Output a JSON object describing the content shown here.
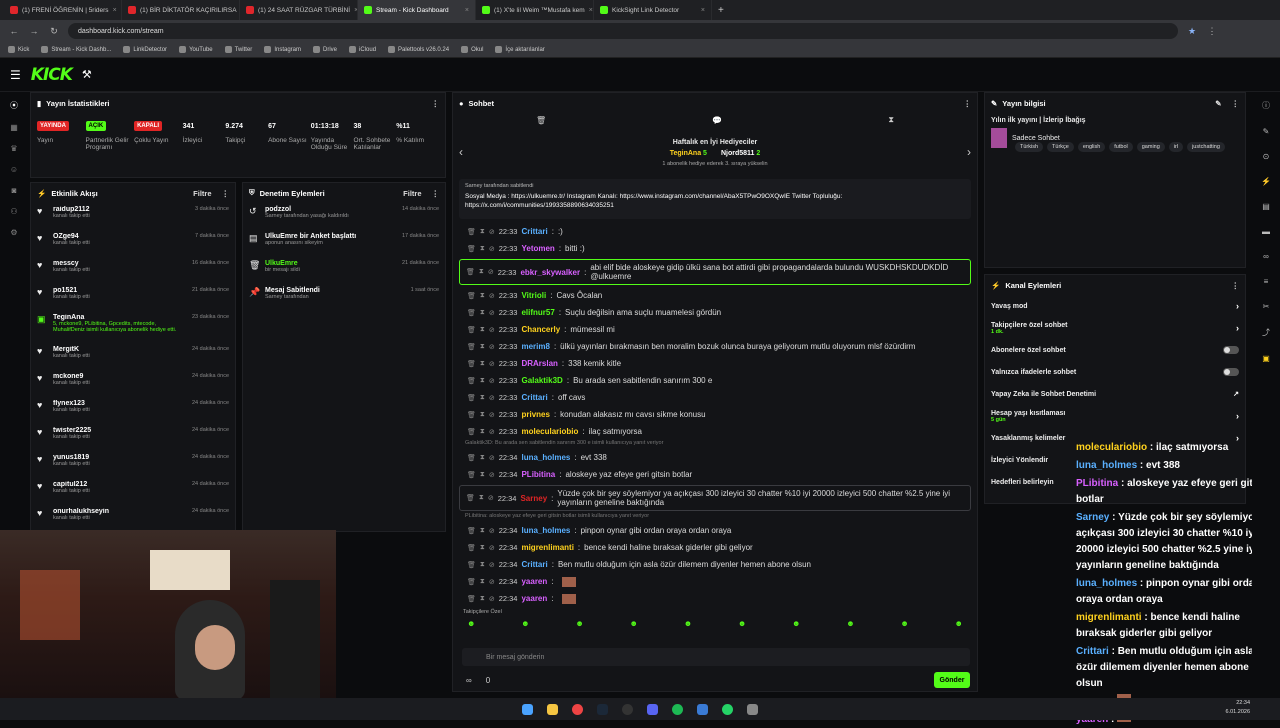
{
  "browser": {
    "tabs": [
      "(1) FRENİ ÖĞRENİN | 5riders",
      "(1) BİR DİKTATÖR KAÇIRILIRSA",
      "(1) 24 SAAT RÜZGAR TÜRBİNİ",
      "Stream - Kick Dashboard",
      "(1) X'te lil Weim ™Mustafa kem",
      "KickSight Link Detector"
    ],
    "url": "dashboard.kick.com/stream",
    "bookmarks": [
      "Kick",
      "Stream - Kick Dashb...",
      "LinkDetector",
      "YouTube",
      "Twitter",
      "Instagram",
      "Drive",
      "iCloud",
      "Palettools v26.0.24",
      "Okul",
      "İçe aktarılanlar"
    ]
  },
  "stats": {
    "title": "Yayın İstatistikleri",
    "items": [
      {
        "value": "YAYINDA",
        "label": "Yayın",
        "kind": "red"
      },
      {
        "value": "AÇIK",
        "label": "Partnerlik Gelir Programı",
        "kind": "grn"
      },
      {
        "value": "KAPALI",
        "label": "Çoklu Yayın",
        "kind": "red"
      },
      {
        "value": "341",
        "label": "İzleyici"
      },
      {
        "value": "9.274",
        "label": "Takipçi"
      },
      {
        "value": "67",
        "label": "Abone Sayısı"
      },
      {
        "value": "01:13:18",
        "label": "Yayında Olduğu Süre"
      },
      {
        "value": "38",
        "label": "Ort. Sohbete Katılanlar"
      },
      {
        "value": "%11",
        "label": "% Katılım"
      }
    ]
  },
  "activity": {
    "title": "Etkinlik Akışı",
    "filter": "Filtre",
    "items": [
      {
        "name": "raidup2112",
        "sub": "kanalı takip etti",
        "time": "3 dakika önce"
      },
      {
        "name": "OZge94",
        "sub": "kanalı takip etti",
        "time": "7 dakika önce"
      },
      {
        "name": "messcy",
        "sub": "kanalı takip etti",
        "time": "16 dakika önce"
      },
      {
        "name": "po1521",
        "sub": "kanalı takip etti",
        "time": "21 dakika önce"
      },
      {
        "name": "TeginAna",
        "sub": "5, mckone9, PLibitina, Gpcedits, mtecode, MuhalifDeniz isimli kullanıcıya abonelik hediye etti.",
        "time": "23 dakika önce"
      },
      {
        "name": "MergitK",
        "sub": "kanalı takip etti",
        "time": "24 dakika önce"
      },
      {
        "name": "mckone9",
        "sub": "kanalı takip etti",
        "time": "24 dakika önce"
      },
      {
        "name": "flynex123",
        "sub": "kanalı takip etti",
        "time": "24 dakika önce"
      },
      {
        "name": "twister2225",
        "sub": "kanalı takip etti",
        "time": "24 dakika önce"
      },
      {
        "name": "yunus1819",
        "sub": "kanalı takip etti",
        "time": "24 dakika önce"
      },
      {
        "name": "capitul212",
        "sub": "kanalı takip etti",
        "time": "24 dakika önce"
      },
      {
        "name": "onurhalukhseyin",
        "sub": "kanalı takip etti",
        "time": "24 dakika önce"
      }
    ]
  },
  "modlog": {
    "title": "Denetim Eylemleri",
    "filter": "Filtre",
    "items": [
      {
        "name": "podzzol",
        "sub": "Sarney tarafından yasağı kaldırıldı",
        "time": "14 dakika önce"
      },
      {
        "name": "UlkuEmre bir Anket başlattı",
        "sub": "aponun anasını sikeyim",
        "time": "17 dakika önce"
      },
      {
        "name": "UlkuEmre",
        "sub": "bir mesajı sildi",
        "time": "21 dakika önce"
      },
      {
        "name": "Mesaj Sabitlendi",
        "sub": "Sarney tarafından",
        "time": "1 saat önce"
      }
    ]
  },
  "chat": {
    "title": "Sohbet",
    "gifter_title": "Haftalık en İyi Hediyeciler",
    "gifter1": "TeginAna",
    "gifter1_count": "5",
    "gifter2": "Njord5811",
    "gifter2_count": "2",
    "gifter_hint": "1 abonelik hediye ederek 3. sıraya yükselin",
    "pinned_by": "Sarney tarafından sabitlendi",
    "pinned_text": "Sosyal Medya : https://ulkuemre.tr/ Instagram Kanalı: https://www.instagram.com/channel/AbaX5TPwO9OXQwIE Twitter Topluluğu: https://x.com/i/communities/1993358890634035251",
    "messages": [
      {
        "time": "22:33",
        "user": "Crittari",
        "color": "#5ab0ff",
        "text": ":)"
      },
      {
        "time": "22:33",
        "user": "Yetomen",
        "color": "#d860ff",
        "text": "bitti :)"
      },
      {
        "time": "22:33",
        "user": "ebkr_skywalker",
        "color": "#d860ff",
        "text": "abi elif bide aloskeye gidip ülkü sana bot attirdi gibi propagandalarda bulundu WUSKDHSKDUDKDİD @ulkuemre"
      },
      {
        "time": "22:33",
        "user": "Vitrioli",
        "color": "#53fc18",
        "text": "Cavs Ôcalan"
      },
      {
        "time": "22:33",
        "user": "elifnur57",
        "color": "#53fc18",
        "text": "Suçlu değilsin ama suçlu muamelesi gördün"
      },
      {
        "time": "22:33",
        "user": "Chancerly",
        "color": "#ffd21e",
        "text": "mümessil mi"
      },
      {
        "time": "22:33",
        "user": "merim8",
        "color": "#5ab0ff",
        "text": "ülkü yayınları bırakmasın ben moralim bozuk olunca buraya geliyorum mutlu oluyorum mlsf özürdirm"
      },
      {
        "time": "22:33",
        "user": "DRArslan",
        "color": "#d860ff",
        "text": "338 kemik kitle"
      },
      {
        "time": "22:33",
        "user": "Galaktik3D",
        "color": "#53fc18",
        "text": "Bu arada sen sabitlendin sanırım 300 e"
      },
      {
        "time": "22:33",
        "user": "Crittari",
        "color": "#5ab0ff",
        "text": "off cavs"
      },
      {
        "time": "22:33",
        "user": "privnes",
        "color": "#ffd21e",
        "text": "konudan alakasız mı cavsı sikme konusu"
      },
      {
        "time": "22:33",
        "user": "moleculariobio",
        "color": "#ffd21e",
        "text": "ilaç satmıyorsa"
      },
      {
        "time": "22:34",
        "user": "luna_holmes",
        "color": "#5ab0ff",
        "text": "evt 338"
      },
      {
        "time": "22:34",
        "user": "PLibitina",
        "color": "#d860ff",
        "text": "aloskeye yaz efeye geri gitsin botlar"
      },
      {
        "time": "22:34",
        "user": "Sarney",
        "color": "#e02525",
        "text": "Yüzde çok bir şey söylemiyor ya açıkçası 300 izleyici 30 chatter %10 iyi 20000 izleyici 500 chatter %2.5 yine iyi yayınların geneline baktığında"
      },
      {
        "time": "22:34",
        "user": "luna_holmes",
        "color": "#5ab0ff",
        "text": "pinpon oynar gibi ordan oraya ordan oraya"
      },
      {
        "time": "22:34",
        "user": "migrenlimanti",
        "color": "#ffd21e",
        "text": "bence kendi haline bıraksak giderler gibi geliyor"
      },
      {
        "time": "22:34",
        "user": "Crittari",
        "color": "#5ab0ff",
        "text": "Ben mutlu olduğum için asla özür dilemem diyenler hemen abone olsun"
      },
      {
        "time": "22:34",
        "user": "yaaren",
        "color": "#d860ff",
        "text": ""
      },
      {
        "time": "22:34",
        "user": "yaaren",
        "color": "#d860ff",
        "text": ""
      }
    ],
    "reply1": "Galaktik3D: Bu arada sen sabitlendin sanırım 300 e isimli kullanıcıya yanıt veriyor",
    "reply2": "PLibitina: aloskeye yaz efeye geri gitsin botlar isimli kullanıcıya yanıt veriyor",
    "followers_only": "Takipçilere Özel",
    "input_placeholder": "Bir mesaj gönderin",
    "send": "Gönder",
    "counter1": "0"
  },
  "info": {
    "title": "Yayın bilgisi",
    "stream_title": "Yılın ilk yayını | İzlerip İbağış",
    "category": "Sadece Sohbet",
    "tags": [
      "Türkish",
      "Türkçe",
      "english",
      "futbol",
      "gaming",
      "irl",
      "justchatting"
    ]
  },
  "channel": {
    "title": "Kanal Eylemleri",
    "rows": [
      {
        "label": "Yavaş mod",
        "kind": "arrow"
      },
      {
        "label": "Takipçilere özel sohbet",
        "sub": "1 dk.",
        "kind": "arrow"
      },
      {
        "label": "Abonelere özel sohbet",
        "kind": "toggle"
      },
      {
        "label": "Yalnızca ifadelerle sohbet",
        "kind": "toggle"
      },
      {
        "label": "Yapay Zeka ile Sohbet Denetimi",
        "kind": "ext"
      },
      {
        "label": "Hesap yaşı kısıtlaması",
        "sub": "5 gün",
        "kind": "arrow"
      },
      {
        "label": "Yasaklanmış kelimeler",
        "kind": "arrow"
      },
      {
        "label": "İzleyici Yönlendir",
        "kind": "none"
      },
      {
        "label": "Hedefleri belirleyin",
        "kind": "none"
      }
    ]
  },
  "overlay": [
    {
      "user": "moleculariobio",
      "color": "#ffd21e",
      "text": "ilaç satmıyorsa"
    },
    {
      "user": "luna_holmes",
      "color": "#5ab0ff",
      "text": "evt 388"
    },
    {
      "user": "PLibitina",
      "color": "#d860ff",
      "text": "aloskeye yaz efeye geri gitsin botlar"
    },
    {
      "user": "Sarney",
      "color": "#5ab0ff",
      "text": "Yüzde çok bir şey söylemiyor ya açıkçası 300 izleyici 30 chatter %10 iyi 20000 izleyici 500 chatter %2.5 yine iyi yayınların geneline baktığında"
    },
    {
      "user": "luna_holmes",
      "color": "#5ab0ff",
      "text": "pinpon oynar gibi ordan oraya ordan oraya"
    },
    {
      "user": "migrenlimanti",
      "color": "#ffd21e",
      "text": "bence kendi haline bıraksak giderler gibi geliyor"
    },
    {
      "user": "Crittari",
      "color": "#5ab0ff",
      "text": "Ben mutlu olduğum için asla özür dilemem diyenler hemen abone olsun"
    },
    {
      "user": "yaaren",
      "color": "#d860ff",
      "text": ""
    },
    {
      "user": "yaaren",
      "color": "#d860ff",
      "text": ""
    }
  ],
  "clock": {
    "time": "22:34",
    "date": "6.01.2026"
  }
}
